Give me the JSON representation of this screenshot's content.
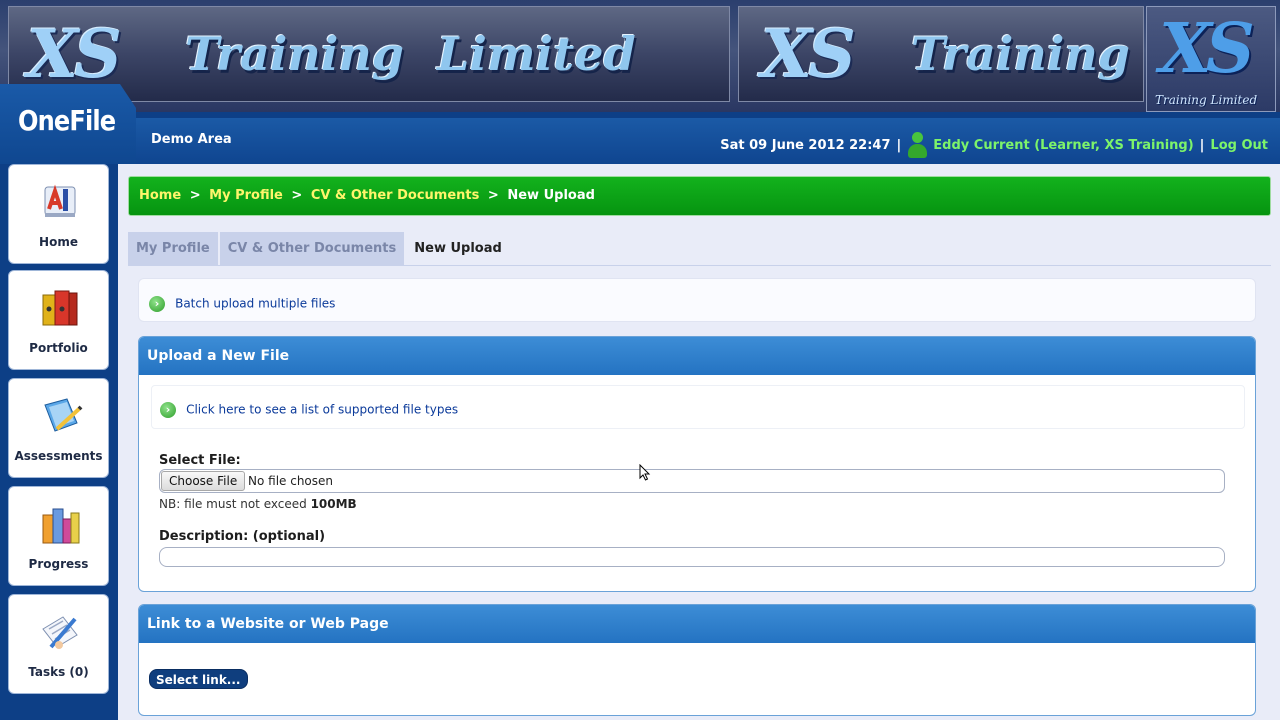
{
  "banner": {
    "logo_left_xs": "XS",
    "logo_left_word1": "Training",
    "logo_left_word2": "Limited",
    "logo_right_xs": "XS",
    "logo_right_word": "Training",
    "badge_xs": "XS",
    "badge_sub": "Training Limited"
  },
  "app": {
    "name": "OneFile"
  },
  "header": {
    "area": "Demo Area",
    "datetime": "Sat 09 June 2012 22:47",
    "separator": "|",
    "user": "Eddy Current (Learner, XS Training)",
    "logout": "Log Out"
  },
  "sidebar": {
    "items": [
      {
        "label": "Home",
        "icon": "home-icon"
      },
      {
        "label": "Portfolio",
        "icon": "portfolio-icon"
      },
      {
        "label": "Assessments",
        "icon": "assessments-icon"
      },
      {
        "label": "Progress",
        "icon": "progress-icon"
      },
      {
        "label": "Tasks (0)",
        "icon": "tasks-icon"
      }
    ]
  },
  "breadcrumb": {
    "items": [
      "Home",
      "My Profile",
      "CV & Other Documents"
    ],
    "separator": ">",
    "current": "New Upload"
  },
  "tabs": [
    "My Profile",
    "CV & Other Documents",
    "New Upload"
  ],
  "batch": {
    "link": "Batch upload multiple files"
  },
  "upload": {
    "title": "Upload a New File",
    "supported_link": "Click here to see a list of supported file types",
    "select_label": "Select File:",
    "choose_button": "Choose File",
    "no_file": "No file chosen",
    "nb_prefix": "NB: file must not exceed",
    "nb_size": "100MB",
    "description_label": "Description: (optional)"
  },
  "link_section": {
    "title": "Link to a Website or Web Page",
    "button": "Select link..."
  },
  "colors": {
    "header_blue": "#0f4590",
    "breadcrumb_green": "#069410",
    "link_yellow": "#fff56b",
    "user_green": "#7df46a",
    "panel_blue": "#2473c2"
  }
}
